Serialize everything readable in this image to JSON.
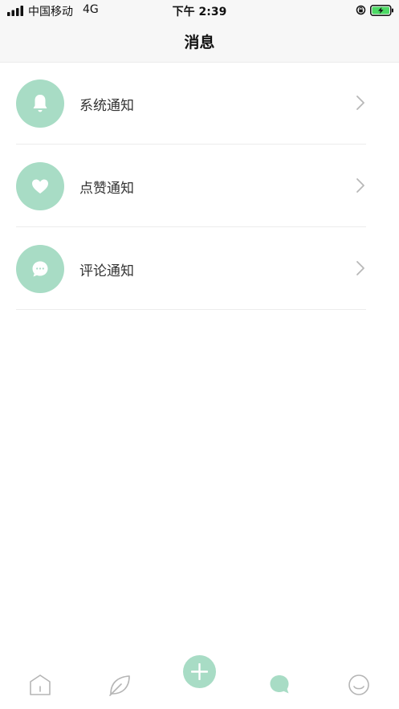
{
  "status_bar": {
    "carrier": "中国移动",
    "network": "4G",
    "time": "下午 2:39"
  },
  "header": {
    "title": "消息"
  },
  "list": {
    "items": [
      {
        "label": "系统通知",
        "icon": "bell-icon"
      },
      {
        "label": "点赞通知",
        "icon": "heart-icon"
      },
      {
        "label": "评论通知",
        "icon": "comment-icon"
      }
    ]
  },
  "tabbar": {
    "tabs": [
      {
        "icon": "home-icon",
        "active": false
      },
      {
        "icon": "leaf-icon",
        "active": false
      },
      {
        "icon": "plus-icon",
        "active": false
      },
      {
        "icon": "message-icon",
        "active": true
      },
      {
        "icon": "smile-icon",
        "active": false
      }
    ]
  },
  "colors": {
    "accent": "#a8dcc5",
    "battery_green": "#4cd964",
    "inactive_icon": "#b5b5b5",
    "divider": "#ececec"
  }
}
